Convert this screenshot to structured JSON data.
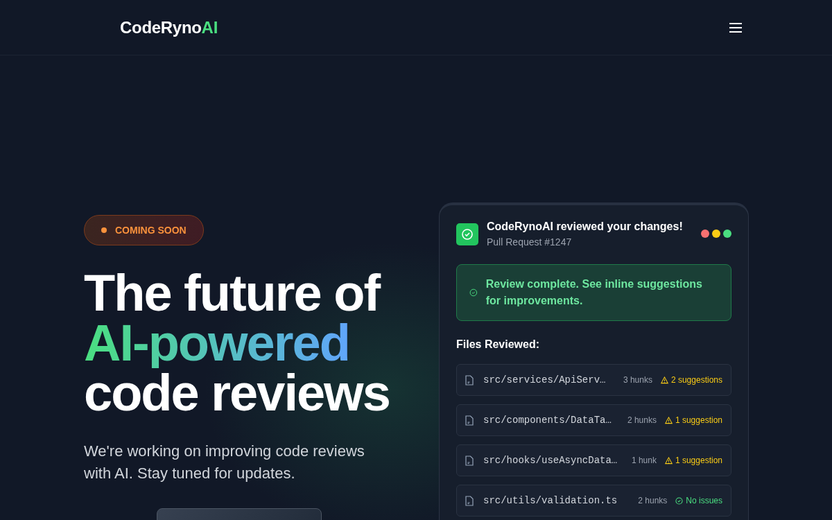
{
  "nav": {
    "logo": {
      "main": "CodeRyno",
      "accent": "AI"
    }
  },
  "hero": {
    "badge": "COMING SOON",
    "headline": [
      {
        "text": "The future of",
        "kind": "plain"
      },
      {
        "text": "AI-powered",
        "kind": "gradient"
      },
      {
        "text": "code reviews",
        "kind": "plain"
      }
    ],
    "subtitle": "We're working on improving code reviews with AI. Stay tuned for updates."
  },
  "card": {
    "title": "CodeRynoAI reviewed your changes!",
    "subtitle": "Pull Request #1247",
    "dots": [
      {
        "color": "#f87171"
      },
      {
        "color": "#facc15"
      },
      {
        "color": "#4ade80"
      }
    ],
    "alert": "Review complete. See inline suggestions for improvements.",
    "files_heading": "Files Reviewed:",
    "files": [
      {
        "path": "src/services/ApiServ…",
        "hunks": "3 hunks",
        "status": "2 suggestions",
        "kind": "warning"
      },
      {
        "path": "src/components/DataTa…",
        "hunks": "2 hunks",
        "status": "1 suggestion",
        "kind": "warning"
      },
      {
        "path": "src/hooks/useAsyncData…",
        "hunks": "1 hunk",
        "status": "1 suggestion",
        "kind": "warning"
      },
      {
        "path": "src/utils/validation.ts",
        "hunks": "2 hunks",
        "status": "No issues",
        "kind": "ok"
      }
    ]
  }
}
